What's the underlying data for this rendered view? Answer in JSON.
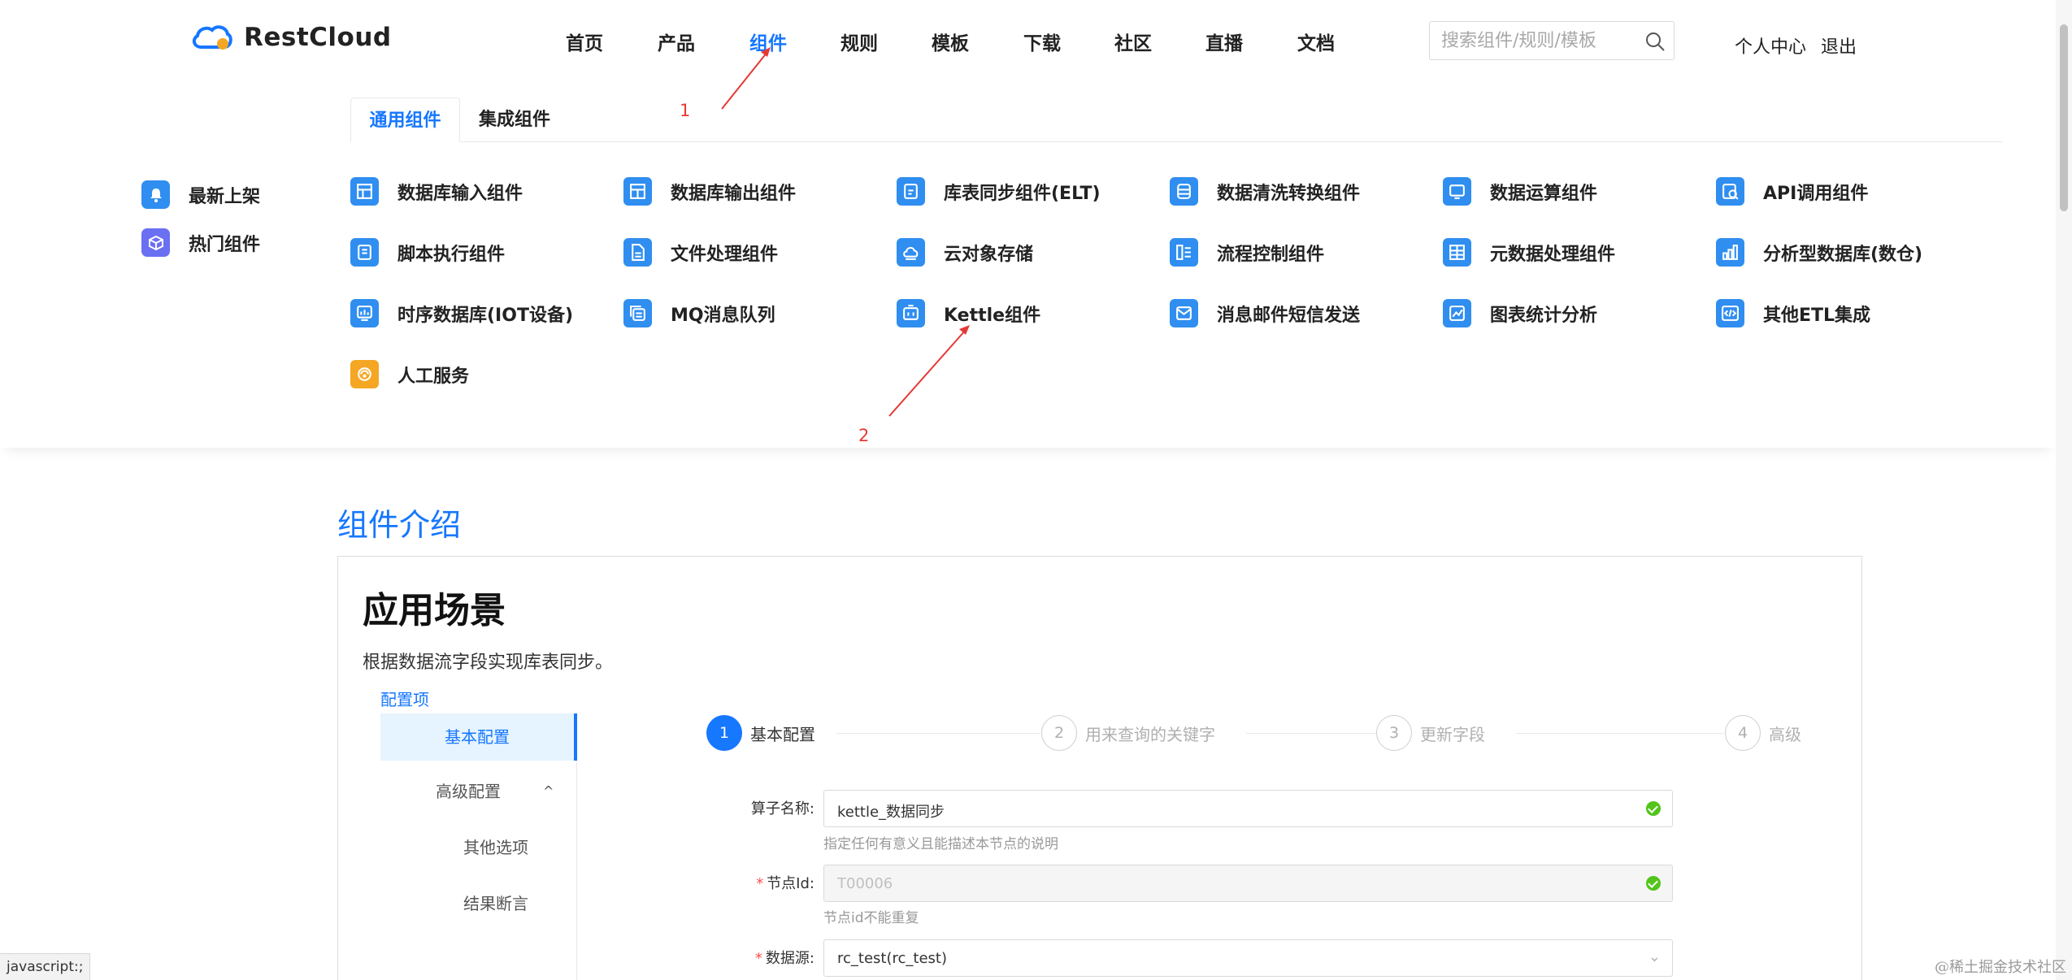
{
  "brand": {
    "name": "RestCloud"
  },
  "nav": {
    "items": [
      {
        "label": "首页"
      },
      {
        "label": "产品"
      },
      {
        "label": "组件"
      },
      {
        "label": "规则"
      },
      {
        "label": "模板"
      },
      {
        "label": "下载"
      },
      {
        "label": "社区"
      },
      {
        "label": "直播"
      },
      {
        "label": "文档"
      }
    ],
    "active": "组件"
  },
  "search": {
    "placeholder": "搜索组件/规则/模板"
  },
  "user_links": {
    "center": "个人中心",
    "logout": "退出"
  },
  "mega_menu": {
    "tabs": [
      {
        "label": "通用组件"
      },
      {
        "label": "集成组件"
      }
    ],
    "side_items": [
      {
        "label": "最新上架",
        "icon": "bell-icon",
        "color": "#2f8ef0"
      },
      {
        "label": "热门组件",
        "icon": "box-icon",
        "color": "#6b6ff2"
      }
    ],
    "components": [
      {
        "label": "数据库输入组件",
        "icon": "table-icon"
      },
      {
        "label": "数据库输出组件",
        "icon": "table-icon"
      },
      {
        "label": "库表同步组件(ELT)",
        "icon": "sync-icon"
      },
      {
        "label": "数据清洗转换组件",
        "icon": "database-icon"
      },
      {
        "label": "数据运算组件",
        "icon": "monitor-icon"
      },
      {
        "label": "API调用组件",
        "icon": "api-icon"
      },
      {
        "label": "脚本执行组件",
        "icon": "script-icon"
      },
      {
        "label": "文件处理组件",
        "icon": "file-icon"
      },
      {
        "label": "云对象存储",
        "icon": "cloud-icon"
      },
      {
        "label": "流程控制组件",
        "icon": "flow-icon"
      },
      {
        "label": "元数据处理组件",
        "icon": "grid-icon"
      },
      {
        "label": "分析型数据库(数仓)",
        "icon": "bar-chart-icon"
      },
      {
        "label": "时序数据库(IOT设备)",
        "icon": "monitor-icon"
      },
      {
        "label": "MQ消息队列",
        "icon": "queue-icon"
      },
      {
        "label": "Kettle组件",
        "icon": "kettle-icon"
      },
      {
        "label": "消息邮件短信发送",
        "icon": "mail-icon"
      },
      {
        "label": "图表统计分析",
        "icon": "line-chart-icon"
      },
      {
        "label": "其他ETL集成",
        "icon": "code-icon"
      },
      {
        "label": "人工服务",
        "icon": "support-icon",
        "color": "#f5a623"
      }
    ]
  },
  "annotations": [
    {
      "label": "1"
    },
    {
      "label": "2"
    }
  ],
  "intro": {
    "section_title": "组件介绍",
    "card_title": "应用场景",
    "description": "根据数据流字段实现库表同步。",
    "config_label": "配置项",
    "config_menu": [
      {
        "label": "基本配置"
      },
      {
        "label": "高级配置"
      },
      {
        "label": "其他选项"
      },
      {
        "label": "结果断言"
      }
    ],
    "steps": [
      {
        "num": "1",
        "label": "基本配置"
      },
      {
        "num": "2",
        "label": "用来查询的关键字"
      },
      {
        "num": "3",
        "label": "更新字段"
      },
      {
        "num": "4",
        "label": "高级"
      }
    ],
    "fields": [
      {
        "label": "算子名称:",
        "required": false,
        "value": "kettle_数据同步",
        "help": "指定任何有意义且能描述本节点的说明"
      },
      {
        "label": "节点Id:",
        "required": true,
        "value": "T00006",
        "help": "节点id不能重复"
      },
      {
        "label": "数据源:",
        "required": true,
        "value": "rc_test(rc_test)",
        "help": ""
      }
    ],
    "required_mark": "*"
  },
  "status_bar": {
    "url": "javascript:;"
  },
  "watermark": "@稀土掘金技术社区",
  "colors": {
    "accent": "#1677ff",
    "icon_blue": "#2f8ef0",
    "annotation_red": "#e53935"
  }
}
